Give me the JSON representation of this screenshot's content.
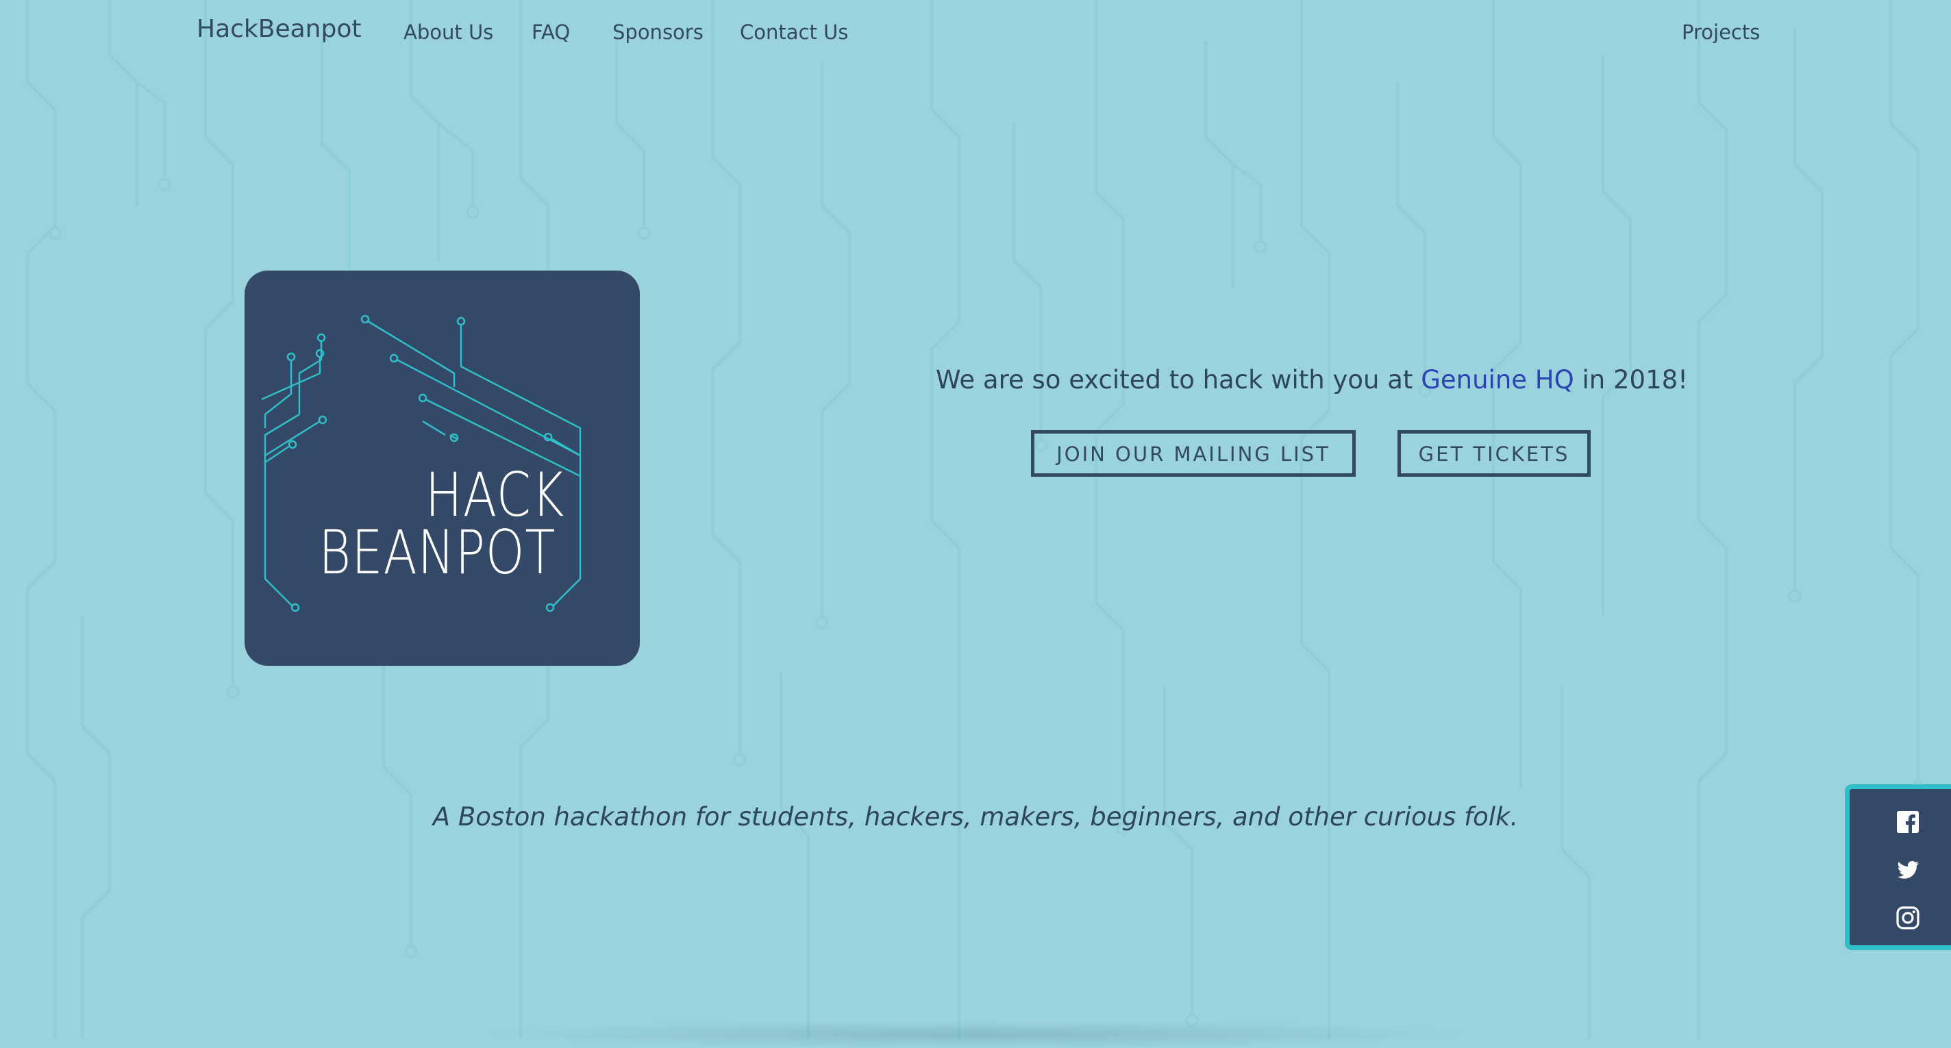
{
  "nav": {
    "brand": "HackBeanpot",
    "items": [
      {
        "label": "About Us"
      },
      {
        "label": "FAQ"
      },
      {
        "label": "Sponsors"
      },
      {
        "label": "Contact Us"
      }
    ],
    "projects": "Projects"
  },
  "logo": {
    "line1": "HACK",
    "line2": "BEANPOT"
  },
  "hero": {
    "text_before": "We are so excited to hack with you at ",
    "link_text": "Genuine HQ",
    "text_after": " in 2018!",
    "mailing_button": "JOIN OUR MAILING LIST",
    "tickets_button": "GET TICKETS"
  },
  "tagline": "A Boston hackathon for students, hackers, makers, beginners, and other curious folk.",
  "social": {
    "icons": [
      "facebook-icon",
      "twitter-icon",
      "instagram-icon"
    ]
  },
  "colors": {
    "background": "#9bd3dd",
    "circuit": "#8ccdd8",
    "logo_bg": "#344867",
    "logo_lines": "#2fbfc9",
    "text": "#2f4a68",
    "link": "#2c43b5",
    "social_border": "#2fbfc9"
  }
}
